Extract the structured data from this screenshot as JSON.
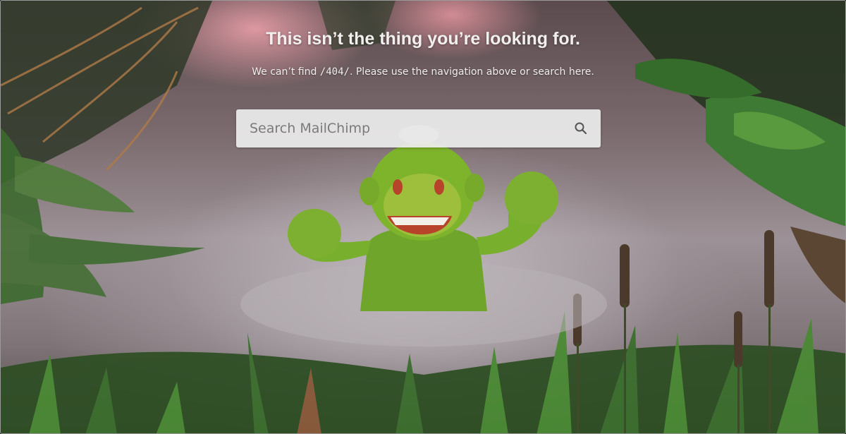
{
  "page": {
    "headline": "This isn’t the thing you’re looking for.",
    "subline_before": "We can’t find ",
    "subline_path": "/404/",
    "subline_after": ". Please use the navigation above or search here."
  },
  "search": {
    "placeholder": "Search MailChimp",
    "icon": "search-icon"
  },
  "colors": {
    "headline": "#f2f0ee",
    "search_bg": "#ececec",
    "placeholder": "#7b7b7b",
    "foliage": "#3f7a34",
    "monkey": "#7fb52e"
  }
}
